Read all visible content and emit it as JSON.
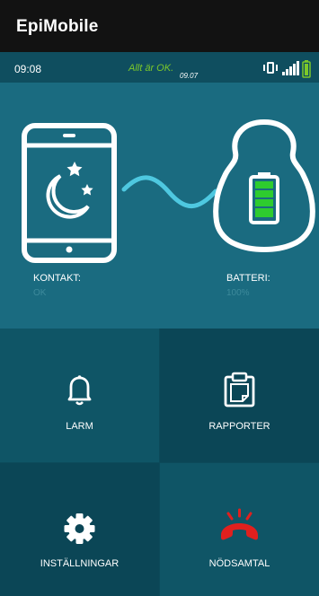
{
  "app": {
    "title": "EpiMobile"
  },
  "status": {
    "time": "09:08",
    "message": "Allt är OK.",
    "message_time": "09.07",
    "icons": [
      "vibrate-icon",
      "signal-icon",
      "battery-icon"
    ]
  },
  "monitor": {
    "contact_label": "KONTAKT:",
    "contact_value": "OK",
    "battery_label": "BATTERI:",
    "battery_value": "100%",
    "phone_icon": "phone-moon-stars-icon",
    "device_icon": "device-battery-icon",
    "link_icon": "wave-connection-icon",
    "battery_level": 1.0
  },
  "tiles": [
    {
      "label": "LARM",
      "icon": "bell-icon"
    },
    {
      "label": "RAPPORTER",
      "icon": "clipboard-icon"
    },
    {
      "label": "INSTÄLLNINGAR",
      "icon": "gear-icon"
    },
    {
      "label": "NÖDSAMTAL",
      "icon": "emergency-phone-icon"
    }
  ],
  "colors": {
    "appbar": "#121212",
    "status_bg": "#0f4e5f",
    "status_ok": "#7cc82a",
    "hero_bg": "#1a6b80",
    "tile_a": "#0f5566",
    "tile_b": "#0b4656",
    "battery_green": "#2ecc2e",
    "emergency_red": "#e0201e",
    "wave": "#4ec8e0"
  }
}
